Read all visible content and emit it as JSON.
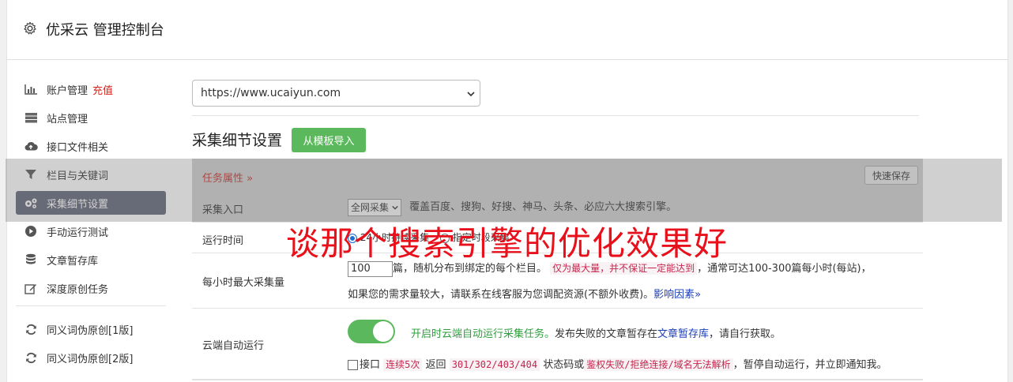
{
  "app": {
    "title": "优采云 管理控制台"
  },
  "sidebar": {
    "items": [
      {
        "label": "账户管理",
        "extra": "充值",
        "icon": "bar-chart-icon"
      },
      {
        "label": "站点管理",
        "icon": "server-icon"
      },
      {
        "label": "接口文件相关",
        "icon": "cloud-upload-icon"
      },
      {
        "label": "栏目与关键词",
        "icon": "filter-icon"
      },
      {
        "label": "采集细节设置",
        "icon": "cogs-icon",
        "active": true
      },
      {
        "label": "手动运行测试",
        "icon": "play-circle-icon"
      },
      {
        "label": "文章暂存库",
        "icon": "database-icon"
      },
      {
        "label": "深度原创任务",
        "icon": "edit-icon"
      },
      {
        "label": "同义词伪原创[1版]",
        "icon": "refresh-icon"
      },
      {
        "label": "同义词伪原创[2版]",
        "icon": "refresh-icon"
      }
    ]
  },
  "site_select": {
    "value": "https://www.ucaiyun.com"
  },
  "section": {
    "title": "采集细节设置",
    "import_button": "从模板导入"
  },
  "task": {
    "label": "任务属性 »",
    "quick_save": "快速保存"
  },
  "collect_entry": {
    "label": "采集入口",
    "select_value": "全网采集",
    "description": "覆盖百度、搜狗、好搜、神马、头条、必应六大搜索引擎。"
  },
  "run_time": {
    "label": "运行时间",
    "option1": "24小时持续采集",
    "option2": "指定时段采集"
  },
  "max_per_hour": {
    "label": "每小时最大采集量",
    "value": "100",
    "text1": "篇，随机分布到绑定的每个栏目。",
    "warn": "仅为最大量，并不保证一定能达到",
    "text2": "，通常可达100-300篇每小时(每站)，",
    "text3": "如果您的需求量较大，请联系在线客服为您调配资源(不额外收费)。",
    "link": "影响因素»"
  },
  "cloud_auto": {
    "label": "云端自动运行",
    "toggle_state": "on",
    "green_text": "开启时云端自动运行采集任务。",
    "text1": "发布失败的文章暂存在",
    "link": "文章暂存库",
    "text2": "，请自行获取。",
    "check_label": "接口",
    "warn1": "连续5次",
    "text3": "返回",
    "warn2": "301/302/403/404",
    "text4": "状态码或",
    "warn3": "鉴权失败/拒绝连接/域名无法解析",
    "text5": "，暂停自动运行，并立即通知我。"
  },
  "overlay_text": "谈那个搜索引擎的优化效果好",
  "colors": {
    "active_sidebar": "#5f6577",
    "green_button": "#5cb85c",
    "warn_red": "#c7254e",
    "link_blue": "#1a3eb8",
    "overlay_red": "#e8101b"
  }
}
